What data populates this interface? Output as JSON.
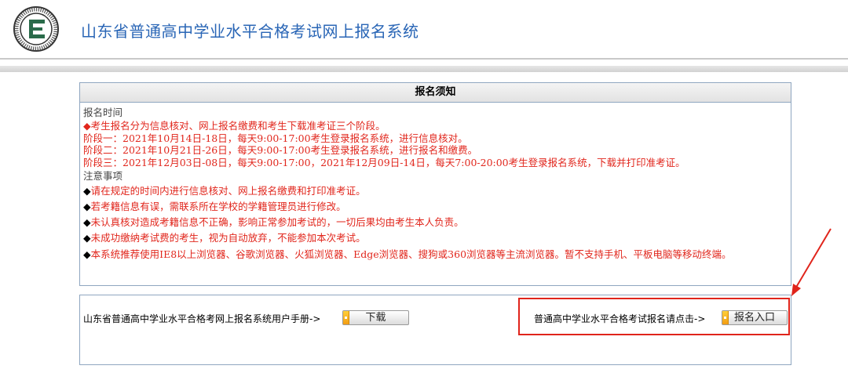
{
  "header": {
    "title": "山东省普通高中学业水平合格考试网上报名系统",
    "logo_icon": "exam-authority-seal-icon"
  },
  "notice": {
    "heading": "报名须知",
    "section_time": "报名时间",
    "time_lines": [
      "◆考生报名分为信息核对、网上报名缴费和考生下载准考证三个阶段。",
      "阶段一：2021年10月14日-18日，每天9:00-17:00考生登录报名系统，进行信息核对。",
      "阶段二：2021年10月21日-26日，每天9:00-17:00考生登录报名系统，进行报名和缴费。",
      "阶段三：2021年12月03日-08日，每天9:00-17:00，2021年12月09日-14日，每天7:00-20:00考生登录报名系统，下载并打印准考证。"
    ],
    "section_notes": "注意事项",
    "bullet": "◆",
    "notes": [
      "请在规定的时间内进行信息核对、网上报名缴费和打印准考证。",
      "若考籍信息有误，需联系所在学校的学籍管理员进行修改。",
      "未认真核对造成考籍信息不正确，影响正常参加考试的，一切后果均由考生本人负责。",
      "未成功缴纳考试费的考生，视为自动放弃，不能参加本次考试。",
      "本系统推荐使用IE8以上浏览器、谷歌浏览器、火狐浏览器、Edge浏览器、搜狗或360浏览器等主流浏览器。暂不支持手机、平板电脑等移动终端。"
    ]
  },
  "panel": {
    "manual_text": "山东省普通高中学业水平合格考网上报名系统用户手册->",
    "download_label": "下载",
    "signup_text": "普通高中学业水平合格考试报名请点击->",
    "signup_label": "报名入口"
  },
  "colors": {
    "title": "#2a66b6",
    "notice_text": "#e1261c",
    "highlight": "#e0241b",
    "border": "#8fa6c0"
  }
}
